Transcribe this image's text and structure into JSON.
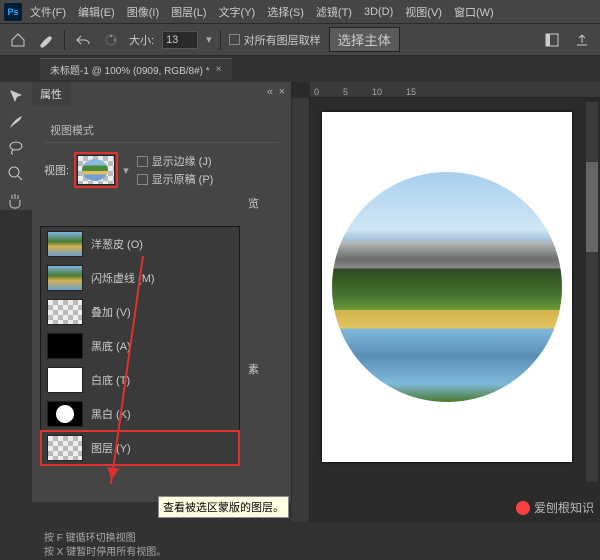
{
  "app_name": "Ps",
  "menu": [
    "文件(F)",
    "编辑(E)",
    "图像(I)",
    "图层(L)",
    "文字(Y)",
    "选择(S)",
    "滤镜(T)",
    "3D(D)",
    "视图(V)",
    "窗口(W)"
  ],
  "options": {
    "size_label": "大小:",
    "size_value": "13",
    "sample_all": "对所有图层取样",
    "select_subject": "选择主体"
  },
  "tab_title": "未标题-1 @ 100% (0909, RGB/8#) *",
  "panel": {
    "title": "属性",
    "subtitle": "视图模式",
    "view_label": "视图:",
    "show_edge": "显示边缘 (J)",
    "show_original": "显示原稿 (P)",
    "preview_label": "览",
    "pixels_label": "素",
    "hint1": "按 F 键循环切换视图",
    "hint2": "按 X 键暂时停用所有视图。"
  },
  "dropdown": [
    {
      "label": "洋葱皮 (O)",
      "style": "photo"
    },
    {
      "label": "闪烁虚线 (M)",
      "style": "photo"
    },
    {
      "label": "叠加 (V)",
      "style": "checker"
    },
    {
      "label": "黑底 (A)",
      "style": "black"
    },
    {
      "label": "白底 (T)",
      "style": "white"
    },
    {
      "label": "黑白 (K)",
      "style": "circle"
    },
    {
      "label": "图层 (Y)",
      "style": "checker",
      "highlight": true
    }
  ],
  "tooltip": "查看被选区蒙版的图层。",
  "ruler_ticks": [
    "0",
    "5",
    "10",
    "15"
  ],
  "watermark": "爱刨根知识"
}
